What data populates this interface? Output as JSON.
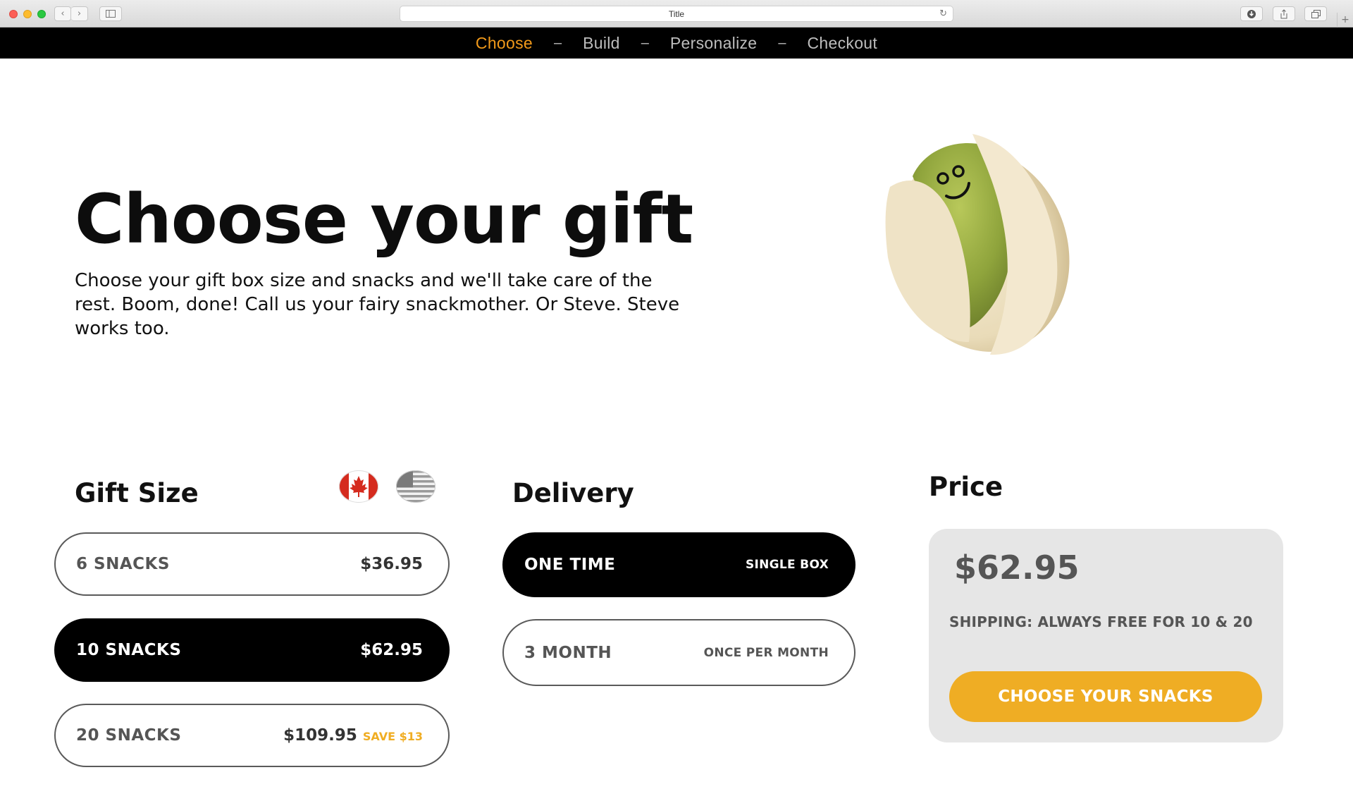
{
  "browser": {
    "title": "Title",
    "icons": [
      "back-icon",
      "forward-icon",
      "sidebar-icon",
      "reload-icon",
      "download-icon",
      "share-icon",
      "tabs-icon",
      "new-tab-icon"
    ]
  },
  "steps": {
    "items": [
      "Choose",
      "Build",
      "Personalize",
      "Checkout"
    ],
    "separator": "–",
    "active_index": 0
  },
  "hero": {
    "title": "Choose your gift",
    "description": "Choose your gift box size and snacks and we'll take care of the rest. Boom, done! Call us your fairy snackmother. Or Steve. Steve works too."
  },
  "gift_size": {
    "heading": "Gift Size",
    "flags": [
      "canada-flag-icon",
      "usa-flag-icon"
    ],
    "options": [
      {
        "label": "6 SNACKS",
        "price": "$36.95",
        "save": "",
        "selected": false
      },
      {
        "label": "10 SNACKS",
        "price": "$62.95",
        "save": "",
        "selected": true
      },
      {
        "label": "20 SNACKS",
        "price": "$109.95",
        "save": "SAVE $13",
        "selected": false
      }
    ]
  },
  "delivery": {
    "heading": "Delivery",
    "options": [
      {
        "label": "ONE TIME",
        "note": "SINGLE BOX",
        "selected": true
      },
      {
        "label": "3 MONTH",
        "note": "ONCE PER MONTH",
        "selected": false
      }
    ]
  },
  "price": {
    "heading": "Price",
    "amount": "$62.95",
    "shipping": "SHIPPING:  ALWAYS FREE FOR 10 & 20",
    "cta": "CHOOSE YOUR SNACKS"
  },
  "colors": {
    "accent_orange": "#f29a1a",
    "cta_yellow": "#efad24",
    "selected_pill": "#000000",
    "card_bg": "#e6e6e6"
  }
}
